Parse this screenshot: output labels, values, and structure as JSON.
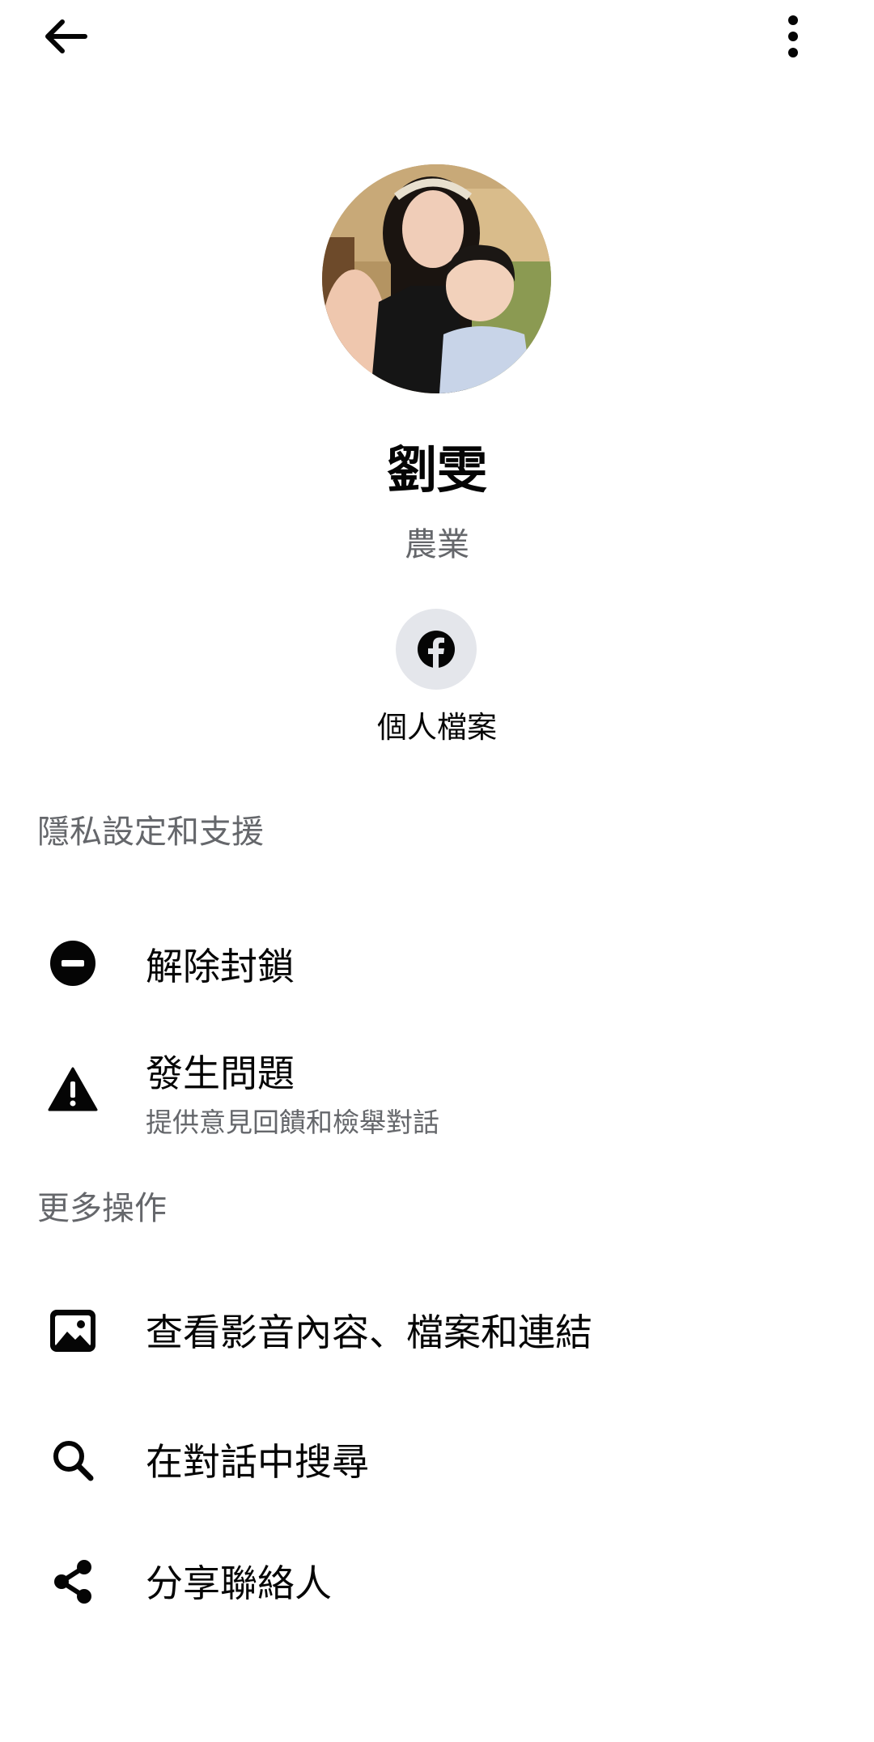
{
  "header": {
    "back_icon": "arrow-left-icon",
    "more_icon": "vertical-ellipsis-icon"
  },
  "profile": {
    "name": "劉雯",
    "subtitle": "農業",
    "facebook_profile_label": "個人檔案"
  },
  "sections": {
    "privacy": {
      "title": "隱私設定和支援",
      "items": [
        {
          "label": "解除封鎖",
          "icon": "minus-circle-icon"
        },
        {
          "label": "發生問題",
          "sub": "提供意見回饋和檢舉對話",
          "icon": "warning-triangle-icon"
        }
      ]
    },
    "more": {
      "title": "更多操作",
      "items": [
        {
          "label": "查看影音內容、檔案和連結",
          "icon": "image-icon"
        },
        {
          "label": "在對話中搜尋",
          "icon": "search-icon"
        },
        {
          "label": "分享聯絡人",
          "icon": "share-icon"
        }
      ]
    }
  },
  "colors": {
    "primary_text": "#050505",
    "secondary_text": "#65676b",
    "icon_bg": "#e4e6eb"
  }
}
